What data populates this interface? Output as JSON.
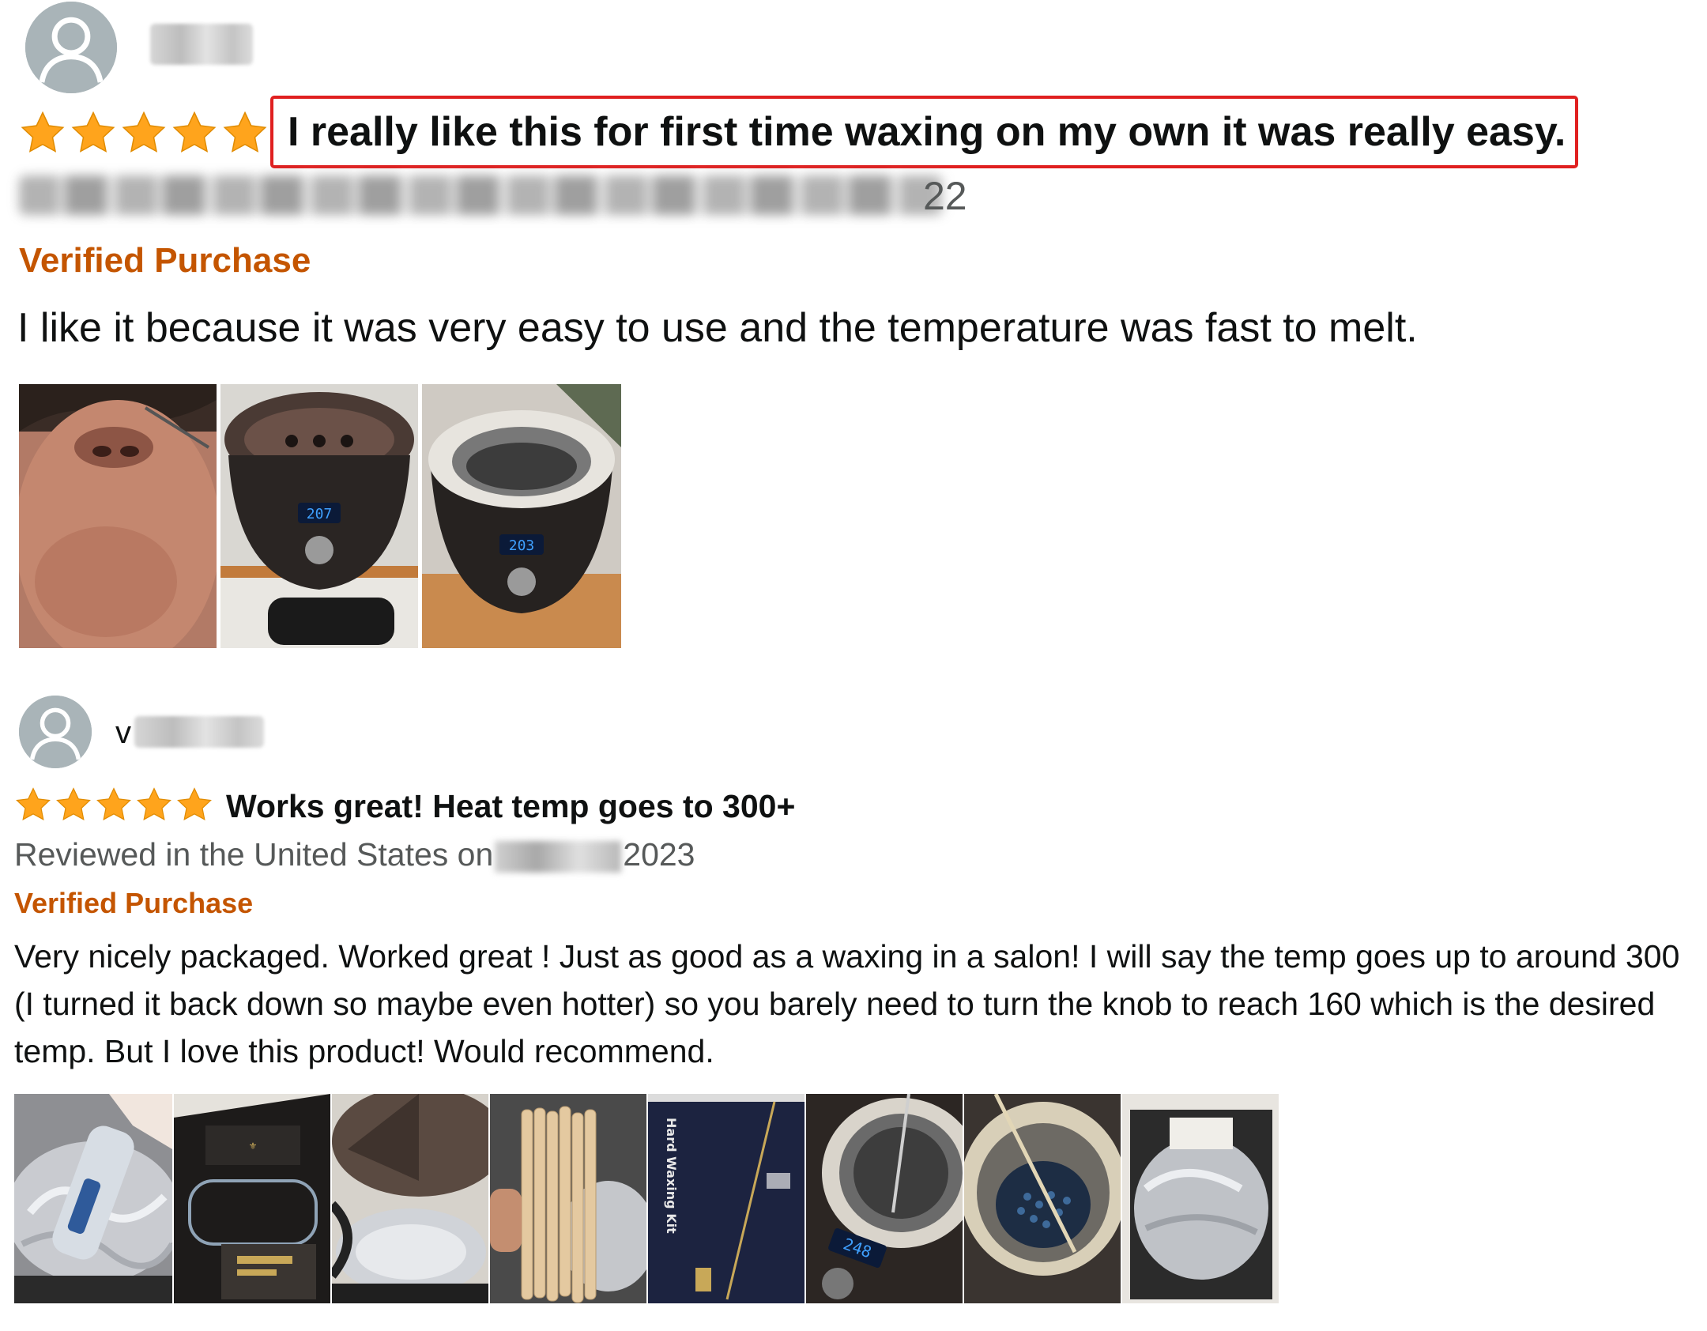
{
  "reviews": [
    {
      "reviewer_name": "",
      "rating": 5,
      "title": "I really like this for first time waxing on my own it was really easy.",
      "reviewed_line_visible_tail": "22",
      "verified": "Verified Purchase",
      "body": "I like it because it was very easy to use and the temperature was fast to melt.",
      "photos": [
        {
          "name": "face-photo"
        },
        {
          "name": "wax-warmer-lid-photo",
          "display": "207"
        },
        {
          "name": "wax-warmer-open-photo",
          "display": "203"
        }
      ]
    },
    {
      "reviewer_name_visible": "v",
      "rating": 5,
      "title": "Works great! Heat temp goes to 300+",
      "reviewed_prefix": "Reviewed in the United States on",
      "reviewed_year": "2023",
      "verified": "Verified Purchase",
      "body": "Very nicely packaged. Worked great ! Just as good as a waxing in a salon! I will say the temp goes up to around 300 (I turned it back down so maybe even hotter) so you barely need to turn the knob to reach 160 which is the desired temp. But I love this product! Would recommend.",
      "photos": [
        {
          "name": "pot-with-foil-photo"
        },
        {
          "name": "kit-box-photo"
        },
        {
          "name": "lid-photo"
        },
        {
          "name": "wooden-sticks-photo"
        },
        {
          "name": "hard-waxing-kit-box-photo",
          "label": "Hard Waxing Kit"
        },
        {
          "name": "warmer-display-photo",
          "display": "248"
        },
        {
          "name": "wax-beads-photo"
        },
        {
          "name": "foil-wrapped-warmer-photo"
        }
      ]
    }
  ],
  "colors": {
    "star": "#ffa41c",
    "verified": "#c45500",
    "highlight_border": "#e02020",
    "avatar_bg": "#a9b4b8",
    "secondary_text": "#565959"
  },
  "icons": [
    "avatar-icon",
    "star-icon"
  ]
}
